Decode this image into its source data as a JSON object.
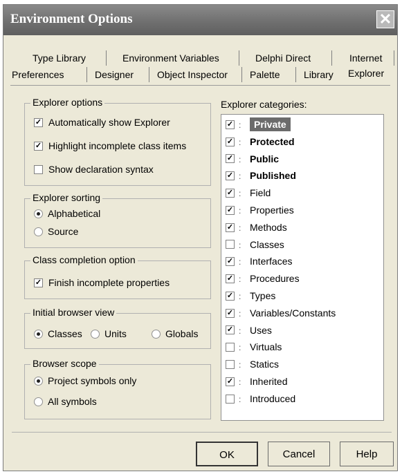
{
  "window": {
    "title": "Environment Options"
  },
  "tabs_row1": [
    "Type Library",
    "Environment Variables",
    "Delphi Direct",
    "Internet"
  ],
  "tabs_row2": [
    "Preferences",
    "Designer",
    "Object Inspector",
    "Palette",
    "Library",
    "Explorer"
  ],
  "explorer_options": {
    "label": "Explorer options",
    "items": [
      {
        "label": "Automatically show Explorer",
        "checked": true
      },
      {
        "label": "Highlight incomplete class items",
        "checked": true
      },
      {
        "label": "Show declaration syntax",
        "checked": false
      }
    ]
  },
  "explorer_sorting": {
    "label": "Explorer sorting",
    "options": [
      {
        "label": "Alphabetical",
        "selected": true
      },
      {
        "label": "Source",
        "selected": false
      }
    ]
  },
  "class_completion": {
    "label": "Class completion option",
    "item": {
      "label": "Finish incomplete properties",
      "checked": true
    }
  },
  "initial_browser_view": {
    "label": "Initial browser view",
    "options": [
      {
        "label": "Classes",
        "selected": true
      },
      {
        "label": "Units",
        "selected": false
      },
      {
        "label": "Globals",
        "selected": false
      }
    ]
  },
  "browser_scope": {
    "label": "Browser scope",
    "options": [
      {
        "label": "Project symbols only",
        "selected": true
      },
      {
        "label": "All symbols",
        "selected": false
      }
    ]
  },
  "categories": {
    "label": "Explorer categories:",
    "items": [
      {
        "label": "Private",
        "checked": true
      },
      {
        "label": "Protected",
        "checked": true
      },
      {
        "label": "Public",
        "checked": true
      },
      {
        "label": "Published",
        "checked": true
      },
      {
        "label": "Field",
        "checked": true
      },
      {
        "label": "Properties",
        "checked": true
      },
      {
        "label": "Methods",
        "checked": true
      },
      {
        "label": "Classes",
        "checked": false
      },
      {
        "label": "Interfaces",
        "checked": true
      },
      {
        "label": "Procedures",
        "checked": true
      },
      {
        "label": "Types",
        "checked": true
      },
      {
        "label": "Variables/Constants",
        "checked": true
      },
      {
        "label": "Uses",
        "checked": true
      },
      {
        "label": "Virtuals",
        "checked": false
      },
      {
        "label": "Statics",
        "checked": false
      },
      {
        "label": "Inherited",
        "checked": true
      },
      {
        "label": "Introduced",
        "checked": false
      }
    ]
  },
  "buttons": {
    "ok": "OK",
    "cancel": "Cancel",
    "help": "Help"
  }
}
